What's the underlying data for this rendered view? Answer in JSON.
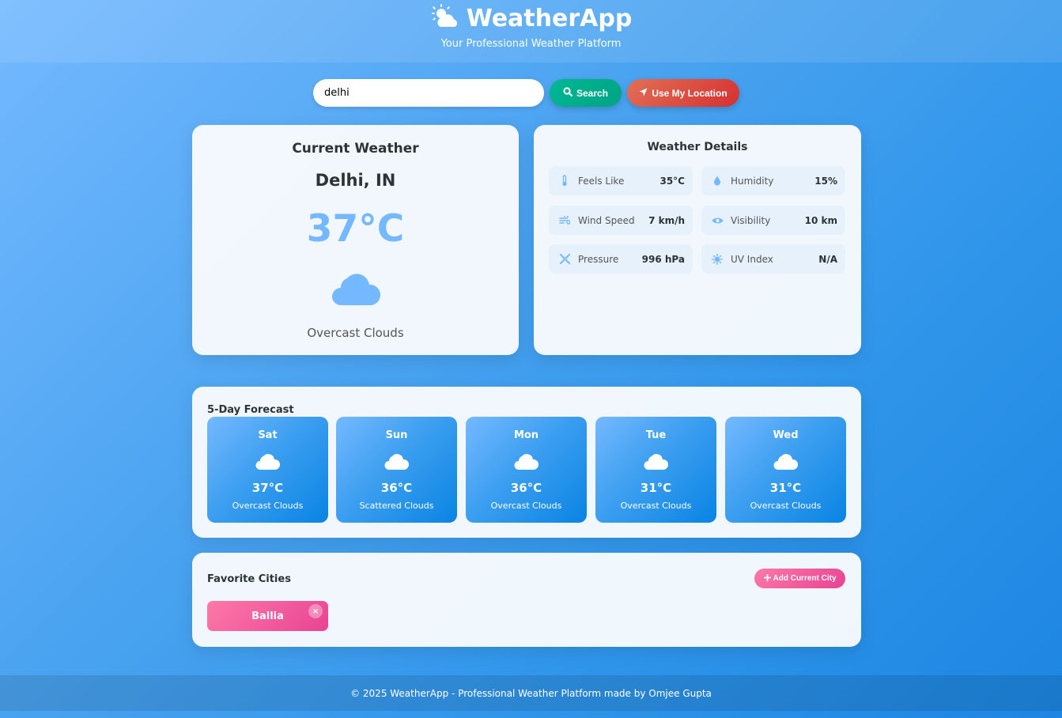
{
  "header": {
    "title": "WeatherApp",
    "tagline": "Your Professional Weather Platform",
    "logo_icon": "sun-cloud-icon"
  },
  "search": {
    "value": "delhi",
    "placeholder": "",
    "search_label": "Search",
    "location_label": "Use My Location"
  },
  "current": {
    "title": "Current Weather",
    "city": "Delhi, IN",
    "temperature": "37°C",
    "condition": "Overcast Clouds",
    "icon": "cloud-icon"
  },
  "details": {
    "title": "Weather Details",
    "items": [
      {
        "label": "Feels Like",
        "value": "35°C",
        "icon": "thermometer-icon"
      },
      {
        "label": "Humidity",
        "value": "15%",
        "icon": "droplet-icon"
      },
      {
        "label": "Wind Speed",
        "value": "7 km/h",
        "icon": "wind-icon"
      },
      {
        "label": "Visibility",
        "value": "10 km",
        "icon": "eye-icon"
      },
      {
        "label": "Pressure",
        "value": "996 hPa",
        "icon": "compress-icon"
      },
      {
        "label": "UV Index",
        "value": "N/A",
        "icon": "sun-icon"
      }
    ]
  },
  "forecast": {
    "title": "5-Day Forecast",
    "days": [
      {
        "day": "Sat",
        "temp": "37°C",
        "desc": "Overcast Clouds"
      },
      {
        "day": "Sun",
        "temp": "36°C",
        "desc": "Scattered Clouds"
      },
      {
        "day": "Mon",
        "temp": "36°C",
        "desc": "Overcast Clouds"
      },
      {
        "day": "Tue",
        "temp": "31°C",
        "desc": "Overcast Clouds"
      },
      {
        "day": "Wed",
        "temp": "31°C",
        "desc": "Overcast Clouds"
      }
    ]
  },
  "favorites": {
    "title": "Favorite Cities",
    "add_label": "Add Current City",
    "cities": [
      "Ballia"
    ],
    "remove_glyph": "×"
  },
  "footer": {
    "text": "© 2025 WeatherApp - Professional Weather Platform made by Omjee Gupta"
  },
  "colors": {
    "accent_temp": "#74b9ff",
    "search_button": "#00b894",
    "location_button": "#e17055",
    "favorite": "#fd79a8"
  }
}
